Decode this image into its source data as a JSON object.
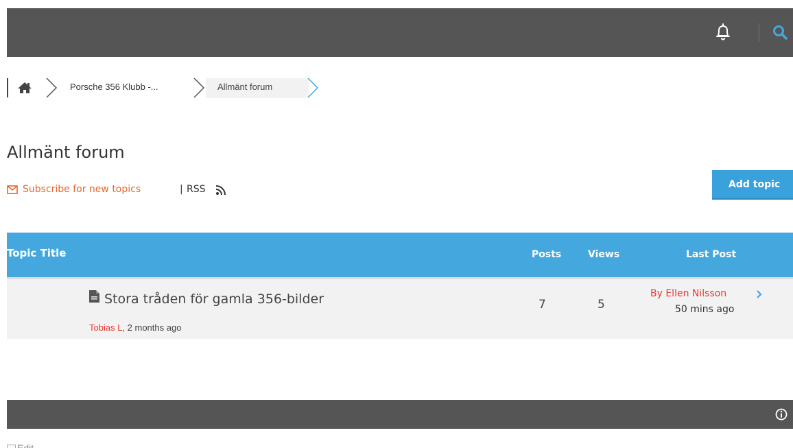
{
  "header": {
    "bell_icon": "bell-icon",
    "search_icon": "search-icon"
  },
  "breadcrumb": {
    "home_icon": "home-icon",
    "items": [
      {
        "label": "Porsche 356 Klubb -..."
      },
      {
        "label": "Allmänt forum"
      }
    ]
  },
  "page": {
    "title": "Allmänt forum",
    "subscribe_label": "Subscribe for new topics",
    "separator": "|",
    "rss_label": "RSS",
    "add_topic_label": "Add topic"
  },
  "table": {
    "columns": {
      "title": "Topic Title",
      "posts": "Posts",
      "views": "Views",
      "last_post": "Last Post"
    },
    "rows": [
      {
        "title": "Stora tråden för gamla 356-bilder",
        "author": "Tobias L",
        "meta_suffix": ", 2 months ago",
        "posts": "7",
        "views": "5",
        "last_post_by": "By Ellen Nilsson",
        "last_post_time": "50 mins ago"
      }
    ]
  },
  "footer": {
    "info_icon": "info-icon",
    "edit_label": "Edit"
  },
  "colors": {
    "bar": "#555555",
    "accent": "#44a8df",
    "orange": "#e8662c",
    "red_link": "#e53935"
  }
}
